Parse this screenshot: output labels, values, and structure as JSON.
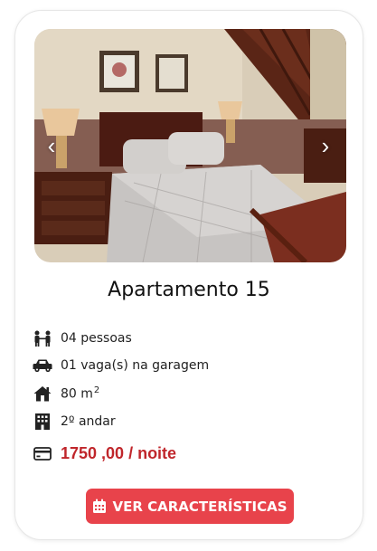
{
  "card": {
    "title": "Apartamento 15",
    "features": [
      {
        "icon": "people-icon",
        "text": "04 pessoas"
      },
      {
        "icon": "car-icon",
        "text": "01 vaga(s) na garagem"
      },
      {
        "icon": "house-icon",
        "text": "80 m",
        "sup": "2"
      },
      {
        "icon": "building-icon",
        "text": "2º andar"
      }
    ],
    "price": {
      "icon": "credit-card-icon",
      "text": "1750 ,00 / noite"
    },
    "button": {
      "icon": "calendar-icon",
      "label": "VER CARACTERÍSTICAS"
    },
    "carousel": {
      "prev_icon": "chevron-left-icon",
      "next_icon": "chevron-right-icon"
    }
  },
  "colors": {
    "accent": "#e8434b",
    "price": "#c0262b",
    "text": "#222222"
  }
}
